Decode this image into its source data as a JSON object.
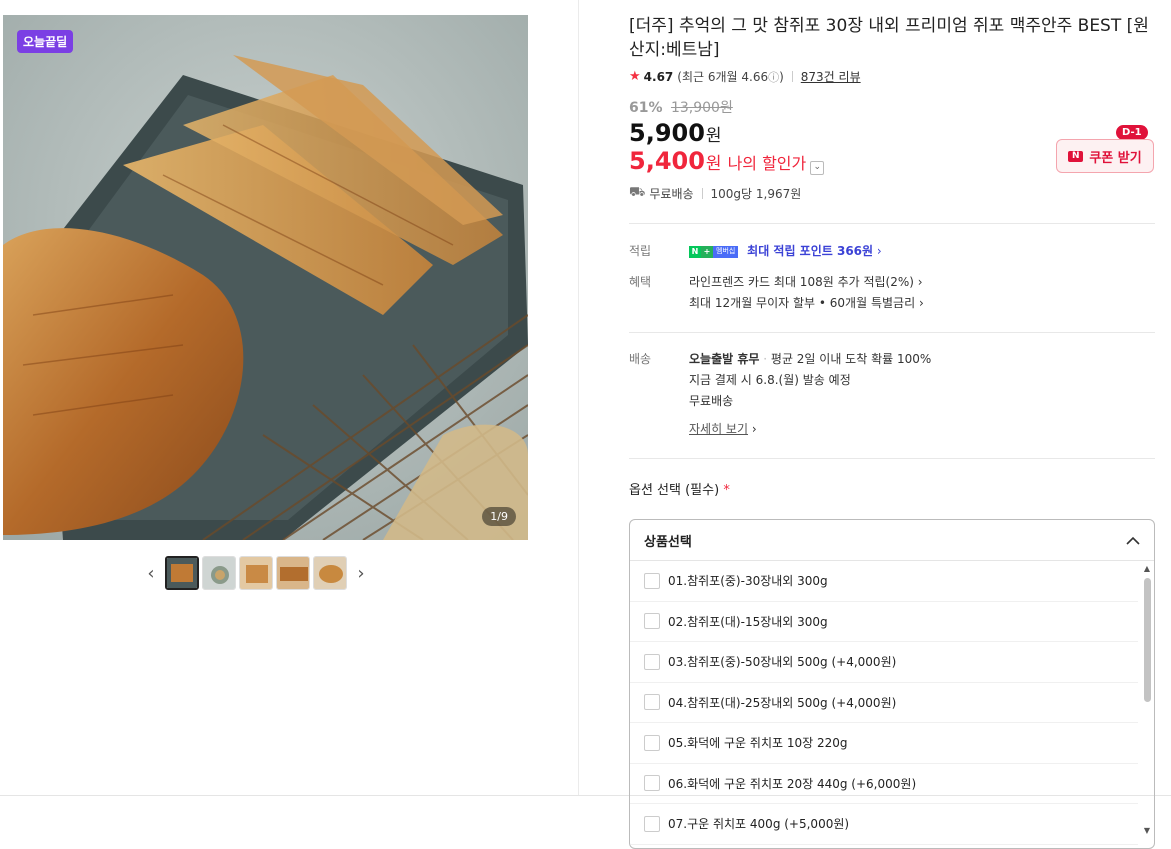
{
  "gallery": {
    "badge": "오늘끝딜",
    "counter": "1/9",
    "prev_icon": "chevron-left-icon",
    "next_icon": "chevron-right-icon",
    "thumbnails": [
      "thumb-1",
      "thumb-2",
      "thumb-3",
      "thumb-4",
      "thumb-5"
    ]
  },
  "product": {
    "title": "[더주] 추억의 그 맛 참쥐포 30장 내외 프리미엄 쥐포 맥주안주 BEST [원산지:베트남]",
    "rating": "4.67",
    "rating_recent": "(최근 6개월 4.66",
    "rating_info_icon": "ⓘ",
    "rating_recent_close": ")",
    "review_count": "873건 리뷰",
    "discount_pct": "61%",
    "original_price": "13,900원",
    "price": "5,900",
    "price_unit": "원",
    "my_price": "5,400",
    "my_price_unit": "원",
    "my_price_label": "나의 할인가",
    "coupon_label": "쿠폰 받기",
    "coupon_dday": "D-1",
    "shipping": "무료배송",
    "unit_price": "100g당 1,967원"
  },
  "benefits": {
    "point_label": "적립",
    "membership_tag": "멤버십",
    "point_text": "최대 적립 포인트 366원",
    "benefit_label": "혜택",
    "card_text": "라인프렌즈 카드 최대 108원 추가 적립(2%)",
    "installment_text": "최대 12개월 무이자 할부 • 60개월 특별금리"
  },
  "delivery": {
    "label": "배송",
    "today": "오늘출발 휴무",
    "avg": "평균 2일 이내 도착 확률 100%",
    "dispatch": "지금 결제 시 6.8.(월) 발송 예정",
    "free": "무료배송",
    "detail_link": "자세히 보기"
  },
  "options": {
    "label": "옵션 선택 (필수)",
    "required_mark": "*",
    "select_placeholder": "상품선택",
    "items": [
      "01.참쥐포(중)-30장내외 300g",
      "02.참쥐포(대)-15장내외 300g",
      "03.참쥐포(중)-50장내외 500g (+4,000원)",
      "04.참쥐포(대)-25장내외 500g (+4,000원)",
      "05.화덕에 구운 쥐치포 10장 220g",
      "06.화덕에 구운 쥐치포 20장 440g (+6,000원)",
      "07.구운 쥐치포 400g (+5,000원)"
    ]
  },
  "colors": {
    "accent_red": "#f0263c",
    "badge_purple": "#7b3fe4",
    "point_blue": "#3b42d6",
    "npay_green": "#03c75a"
  }
}
